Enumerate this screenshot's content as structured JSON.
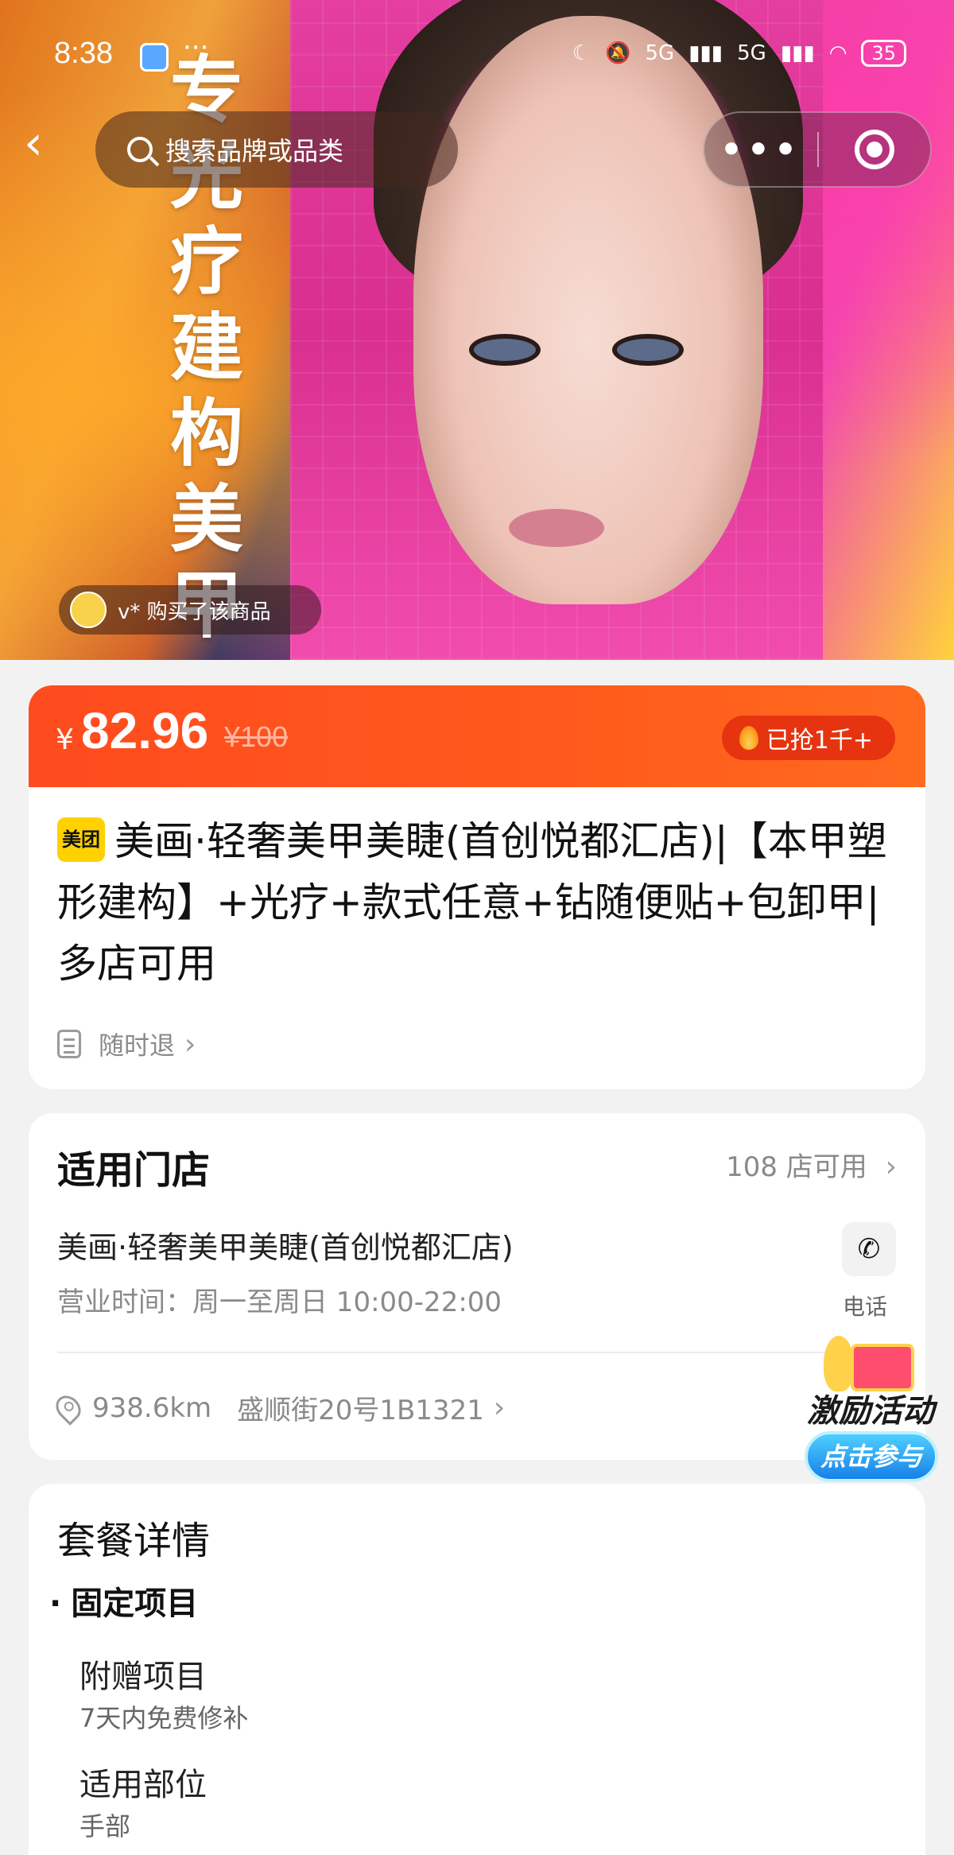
{
  "status_bar": {
    "time": "8:38",
    "dots": "···",
    "signal_1": "5G",
    "signal_2": "5G",
    "battery": "35"
  },
  "nav": {
    "back": "‹",
    "search_placeholder": "搜索品牌或品类",
    "more": "•••"
  },
  "hero": {
    "vertical_text": "专光疗建构美甲",
    "buyer_toast": "v* 购买了该商品"
  },
  "price": {
    "symbol": "¥",
    "current": "82.96",
    "original": "¥100",
    "sold": "已抢1千+"
  },
  "title": {
    "badge": "美团",
    "text": "美画·轻奢美甲美睫(首创悦都汇店)|【本甲塑形建构】+光疗+款式任意+钻随便贴+包卸甲|多店可用",
    "refund_label": "随时退"
  },
  "store": {
    "heading": "适用门店",
    "count": "108 店可用",
    "name": "美画·轻奢美甲美睫(首创悦都汇店)",
    "hours": "营业时间：周一至周日 10:00-22:00",
    "phone_label": "电话",
    "distance": "938.6km",
    "address": "盛顺街20号1B1321"
  },
  "promo": {
    "title": "激励活动",
    "button": "点击参与"
  },
  "package": {
    "heading": "套餐详情",
    "fixed_label": "固定项目",
    "items": [
      {
        "name": "附赠项目",
        "desc": "7天内免费修补"
      },
      {
        "name": "适用部位",
        "desc": "手部"
      }
    ]
  },
  "colors": {
    "accent_orange": "#ff4b1f",
    "badge_yellow": "#ffd100",
    "promo_blue": "#1780e8"
  },
  "icons": [
    "back-arrow-icon",
    "search-icon",
    "more-dots-icon",
    "target-icon",
    "flame-icon",
    "doc-icon",
    "chevron-right-icon",
    "phone-icon",
    "location-pin-icon"
  ]
}
